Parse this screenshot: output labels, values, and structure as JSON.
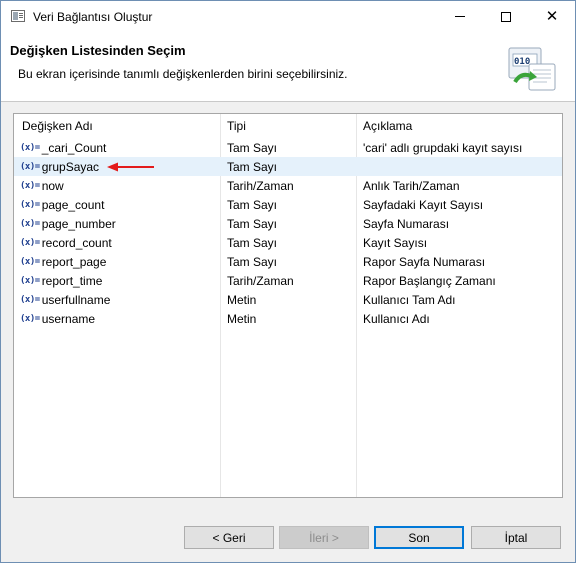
{
  "window": {
    "title": "Veri Bağlantısı Oluştur"
  },
  "header": {
    "title": "Değişken Listesinden Seçim",
    "description": "Bu ekran içerisinde tanımlı değişkenlerden birini seçebilirsiniz."
  },
  "table": {
    "columns": [
      "Değişken Adı",
      "Tipi",
      "Açıklama"
    ],
    "var_icon": "(x)=",
    "rows": [
      {
        "name": "_cari_Count",
        "type": "Tam Sayı",
        "description": "'cari' adlı grupdaki kayıt sayısı"
      },
      {
        "name": "grupSayac",
        "type": "Tam Sayı",
        "description": ""
      },
      {
        "name": "now",
        "type": "Tarih/Zaman",
        "description": "Anlık Tarih/Zaman"
      },
      {
        "name": "page_count",
        "type": "Tam Sayı",
        "description": "Sayfadaki Kayıt Sayısı"
      },
      {
        "name": "page_number",
        "type": "Tam Sayı",
        "description": "Sayfa Numarası"
      },
      {
        "name": "record_count",
        "type": "Tam Sayı",
        "description": "Kayıt Sayısı"
      },
      {
        "name": "report_page",
        "type": "Tam Sayı",
        "description": "Rapor Sayfa Numarası"
      },
      {
        "name": "report_time",
        "type": "Tarih/Zaman",
        "description": "Rapor Başlangıç Zamanı"
      },
      {
        "name": "userfullname",
        "type": "Metin",
        "description": "Kullanıcı Tam Adı"
      },
      {
        "name": "username",
        "type": "Metin",
        "description": "Kullanıcı Adı"
      }
    ],
    "selected_row": "grupSayac"
  },
  "buttons": {
    "back": "< Geri",
    "next": "İleri >",
    "finish": "Son",
    "cancel": "İptal"
  },
  "colors": {
    "selection": "#e5f1fb",
    "arrow": "#e31b1b",
    "default_button_border": "#0078d7"
  },
  "icons": {
    "app": "window-icon",
    "wizard": "data-binding-wizard-icon",
    "variable": "variable-icon",
    "pointer": "red-arrow-icon"
  }
}
